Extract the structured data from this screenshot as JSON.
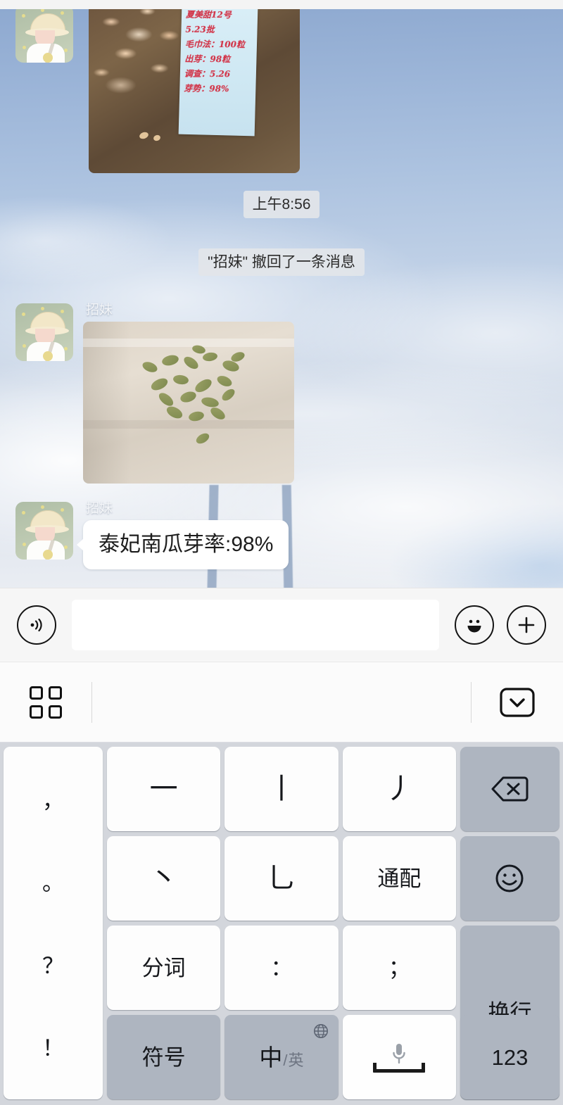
{
  "chat": {
    "time_divider": "上午8:56",
    "system_notice": "\"招妹\" 撤回了一条消息",
    "messages": [
      {
        "sender": "招妹",
        "type": "image",
        "caption": "发芽毛巾盘点照片与手写记录纸条"
      },
      {
        "sender": "招妹",
        "type": "image",
        "caption": "毛巾上摊开的南瓜种子发芽照片"
      },
      {
        "sender": "招妹",
        "type": "text",
        "text": "泰妃南瓜芽率:98%"
      }
    ],
    "handwritten_note": {
      "lines": [
        "夏美甜12号",
        "5.23批",
        "毛巾法：100粒",
        "出芽：98粒",
        "调查：5.26",
        "芽势：98%"
      ]
    }
  },
  "input_bar": {
    "voice_icon": "voice-wave-icon",
    "placeholder": "",
    "value": "",
    "emoji_icon": "emoji-smile-icon",
    "more_icon": "plus-circle-icon"
  },
  "keyboard_toolbar": {
    "panel_icon": "grid-apps-icon",
    "collapse_icon": "chevron-down-boxed-icon"
  },
  "keyboard": {
    "punctuation_key": {
      "name": "punctuation-key",
      "marks": [
        "，",
        "。",
        "？",
        "！"
      ]
    },
    "rows": [
      [
        {
          "name": "stroke-heng-key",
          "label": "一",
          "style": "stroke"
        },
        {
          "name": "stroke-shu-key",
          "label": "丨",
          "style": "stroke"
        },
        {
          "name": "stroke-pie-key",
          "label": "丿",
          "style": "stroke"
        },
        {
          "name": "backspace-key",
          "label": "",
          "style": "fn",
          "icon": "backspace-icon"
        }
      ],
      [
        {
          "name": "stroke-dian-key",
          "label": "丶",
          "style": "stroke"
        },
        {
          "name": "stroke-zhe-key",
          "label": "乚",
          "style": "stroke"
        },
        {
          "name": "wildcard-key",
          "label": "通配",
          "style": "label"
        },
        {
          "name": "emoji-key",
          "label": "",
          "style": "fn",
          "icon": "smiley-icon"
        }
      ],
      [
        {
          "name": "word-split-key",
          "label": "分词",
          "style": "label"
        },
        {
          "name": "colon-key",
          "label": "：",
          "style": "label"
        },
        {
          "name": "semicolon-key",
          "label": "；",
          "style": "label"
        }
      ],
      [
        {
          "name": "symbols-key",
          "label": "符号",
          "style": "fn"
        },
        {
          "name": "language-toggle-key",
          "label_cn": "中",
          "label_sep": "/",
          "label_en": "英",
          "style": "fn",
          "icon": "globe-icon"
        },
        {
          "name": "space-voice-key",
          "label": "",
          "style": "space",
          "icon": "microphone-icon"
        },
        {
          "name": "numbers-key",
          "label": "123",
          "style": "fn"
        }
      ]
    ],
    "enter_key": {
      "name": "newline-key",
      "label": "换行"
    }
  },
  "colors": {
    "keyboard_bg": "#d3d6dc",
    "key_bg": "#fdfdfd",
    "fn_key_bg": "#aeb5c0",
    "bubble_bg": "#ffffff",
    "pill_bg": "#e2e5e9",
    "input_bar_bg": "#f6f6f6"
  }
}
